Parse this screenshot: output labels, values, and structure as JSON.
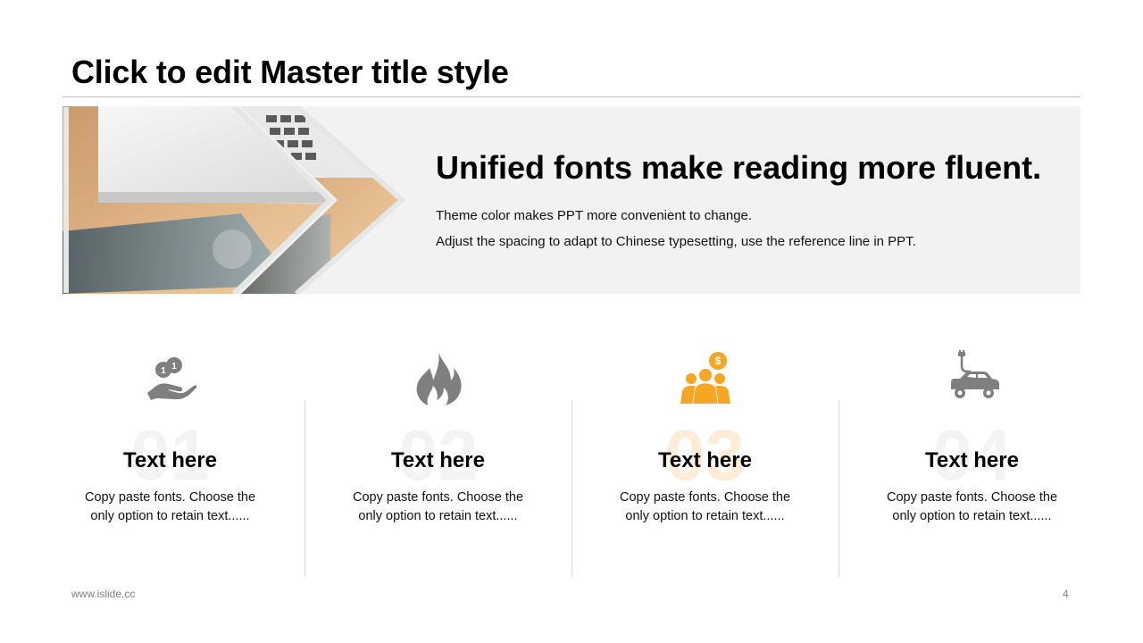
{
  "slide": {
    "title": "Click to edit Master title style",
    "headline": "Unified fonts make reading more fluent.",
    "lines": [
      "Theme color makes PPT more convenient to change.",
      "Adjust the spacing to adapt to Chinese typesetting, use the reference line in PPT."
    ]
  },
  "columns": [
    {
      "number": "01",
      "label": "Text here",
      "desc": "Copy paste fonts. Choose the only option to retain text......",
      "icon": "coin-hand-icon"
    },
    {
      "number": "02",
      "label": "Text here",
      "desc": "Copy paste fonts. Choose the only option to retain text......",
      "icon": "flame-icon"
    },
    {
      "number": "03",
      "label": "Text here",
      "desc": "Copy paste fonts. Choose the only option to retain text......",
      "icon": "team-dollar-icon"
    },
    {
      "number": "04",
      "label": "Text here",
      "desc": "Copy paste fonts. Choose the only option to retain text......",
      "icon": "electric-car-icon"
    }
  ],
  "footer": {
    "url": "www.islide.cc",
    "page": "4"
  },
  "colors": {
    "accent": "#f5a623",
    "icon_gray": "#7f7f7f",
    "banner_bg": "#f2f2f2"
  }
}
